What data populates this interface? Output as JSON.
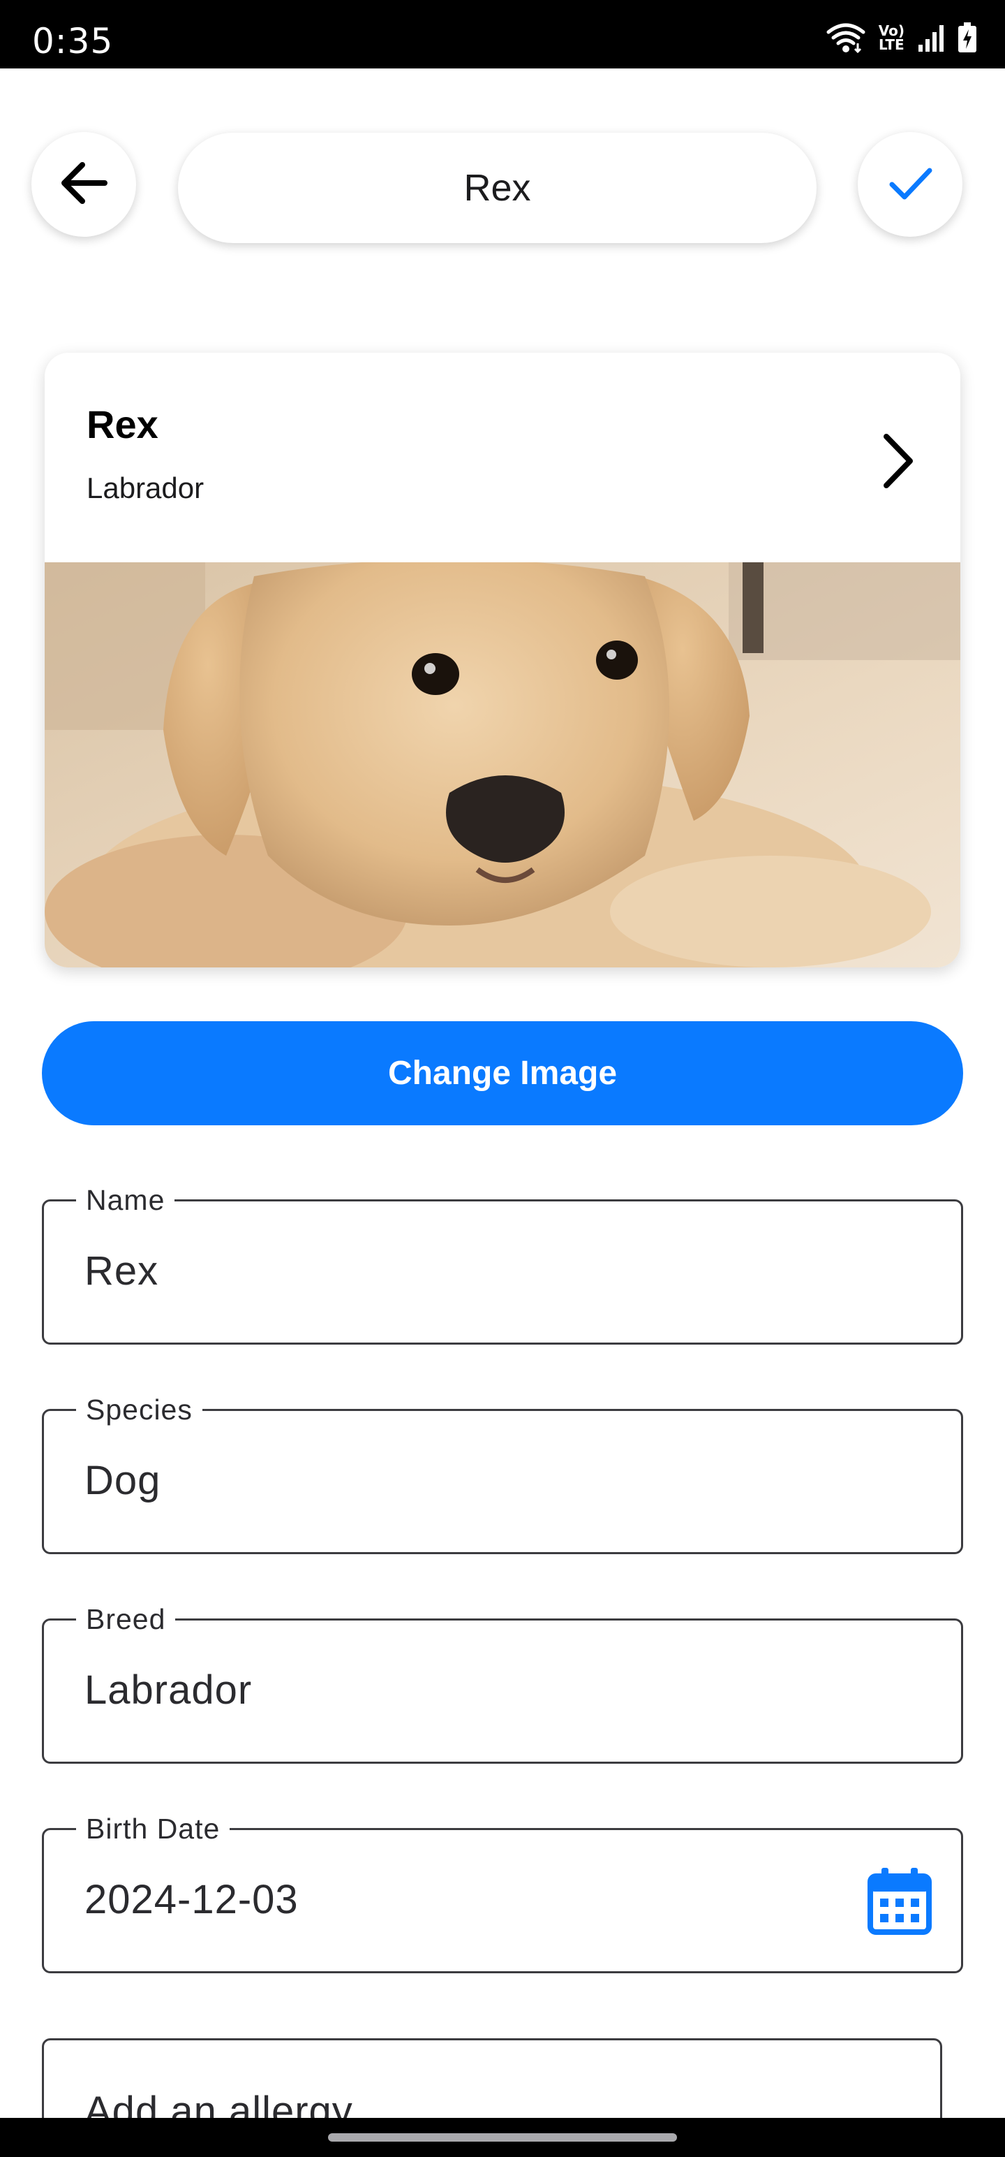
{
  "status_bar": {
    "time": "0:35",
    "volte_top": "Vo)",
    "volte_bottom": "LTE",
    "icons": [
      "wifi-icon",
      "volte-icon",
      "signal-icon",
      "battery-charging-icon"
    ]
  },
  "app_bar": {
    "title": "Rex",
    "back_icon": "arrow-left-icon",
    "confirm_icon": "check-icon",
    "accent": "#0a7aff"
  },
  "pet_card": {
    "name": "Rex",
    "breed": "Labrador",
    "chevron_icon": "chevron-right-icon",
    "photo": "labrador-puppy-photo"
  },
  "change_image_label": "Change Image",
  "fields": {
    "name": {
      "label": "Name",
      "value": "Rex"
    },
    "species": {
      "label": "Species",
      "value": "Dog"
    },
    "breed": {
      "label": "Breed",
      "value": "Labrador"
    },
    "birth_date": {
      "label": "Birth Date",
      "value": "2024-12-03",
      "icon": "calendar-icon"
    }
  },
  "allergy": {
    "placeholder": "Add an allergy"
  }
}
